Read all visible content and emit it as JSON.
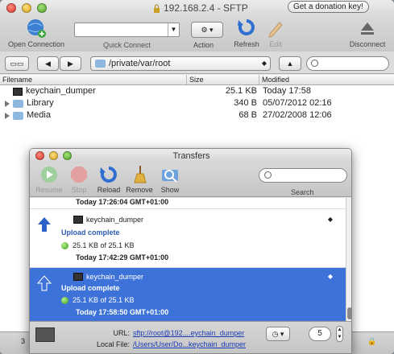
{
  "window": {
    "title": "192.168.2.4 - SFTP",
    "donate_label": "Get a donation key!"
  },
  "toolbar": {
    "open_connection": "Open Connection",
    "quick_connect": "Quick Connect",
    "action": "Action",
    "refresh": "Refresh",
    "edit": "Edit",
    "disconnect": "Disconnect"
  },
  "nav": {
    "path": "/private/var/root"
  },
  "files": {
    "headers": {
      "name": "Filename",
      "size": "Size",
      "modified": "Modified"
    },
    "rows": [
      {
        "name": "keychain_dumper",
        "size": "25.1 KB",
        "modified": "Today 17:58",
        "kind": "file"
      },
      {
        "name": "Library",
        "size": "340 B",
        "modified": "05/07/2012 02:16",
        "kind": "folder"
      },
      {
        "name": "Media",
        "size": "68 B",
        "modified": "27/02/2008 12:06",
        "kind": "folder"
      }
    ]
  },
  "bottom": {
    "count": "3"
  },
  "transfers": {
    "title": "Transfers",
    "toolbar": {
      "resume": "Resume",
      "stop": "Stop",
      "reload": "Reload",
      "remove": "Remove",
      "show": "Show",
      "search": "Search"
    },
    "top_timestamp": "Today 17:26:04 GMT+01:00",
    "items": [
      {
        "name": "keychain_dumper",
        "status": "Upload complete",
        "progress": "25.1 KB of 25.1 KB",
        "timestamp": "Today 17:42:29 GMT+01:00",
        "selected": false
      },
      {
        "name": "keychain_dumper",
        "status": "Upload complete",
        "progress": "25.1 KB of 25.1 KB",
        "timestamp": "Today 17:58:50 GMT+01:00",
        "selected": true
      }
    ],
    "footer": {
      "url_label": "URL:",
      "url_value": "sftp://root@192....eychain_dumper",
      "local_label": "Local File:",
      "local_value": "/Users/User/Do...keychain_dumper",
      "connections": "5"
    }
  }
}
